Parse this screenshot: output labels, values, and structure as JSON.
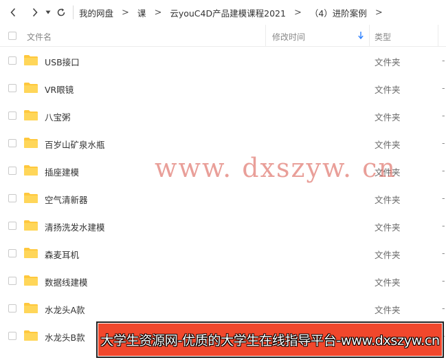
{
  "nav": {
    "back_icon": "chevron-left-icon",
    "forward_icon": "chevron-right-icon",
    "dropdown_icon": "caret-down-icon",
    "refresh_icon": "refresh-icon",
    "separator": ">",
    "breadcrumbs": [
      "我的网盘",
      "课",
      "云youC4D产品建模课程2021",
      "（4）进阶案例"
    ]
  },
  "header": {
    "name": "文件名",
    "modified": "修改时间",
    "type": "类型",
    "sort_icon": "sort-down-arrow-icon",
    "accent": "#2b7fff"
  },
  "files": [
    {
      "name": "USB接口",
      "type": "文件夹",
      "extra": "-"
    },
    {
      "name": "VR眼镜",
      "type": "文件夹",
      "extra": "-"
    },
    {
      "name": "八宝粥",
      "type": "文件夹",
      "extra": "-"
    },
    {
      "name": "百岁山矿泉水瓶",
      "type": "文件夹",
      "extra": "-"
    },
    {
      "name": "插座建模",
      "type": "文件夹",
      "extra": "-"
    },
    {
      "name": "空气清新器",
      "type": "文件夹",
      "extra": "-"
    },
    {
      "name": "清扬洗发水建模",
      "type": "文件夹",
      "extra": "-"
    },
    {
      "name": "森麦耳机",
      "type": "文件夹",
      "extra": "-"
    },
    {
      "name": "数据线建模",
      "type": "文件夹",
      "extra": "-"
    },
    {
      "name": "水龙头A款",
      "type": "文件夹",
      "extra": "-"
    },
    {
      "name": "水龙头B款",
      "type": "文件夹",
      "extra": "-"
    }
  ],
  "folder_color": "#ffc83d",
  "watermark": "www. dxszyw. cn",
  "banner": {
    "text": "大学生资源网-优质的大学生在线指导平台-www.dxszyw.cn",
    "color": "#f1472c"
  }
}
